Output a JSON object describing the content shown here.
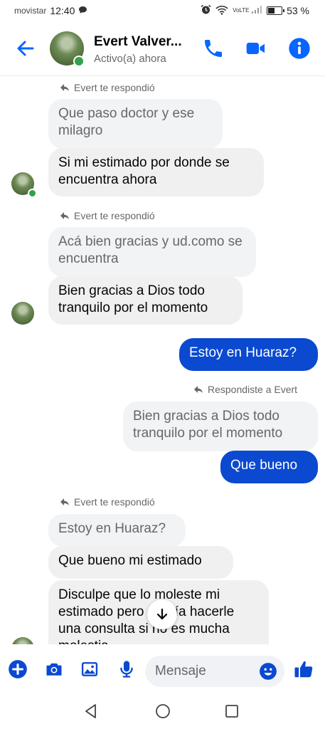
{
  "status_bar": {
    "carrier": "movistar",
    "time": "12:40",
    "volte": "VoLTE",
    "battery_percent": "53 %",
    "battery_level": 0.53
  },
  "header": {
    "contact_name": "Evert Valver...",
    "contact_status": "Activo(a) ahora"
  },
  "messages": [
    {
      "reply_note": "Evert te respondió",
      "quoted": "Que paso doctor y ese milagro",
      "text": "Si mi estimado por donde se encuentra ahora"
    },
    {
      "reply_note": "Evert te respondió",
      "quoted": "Acá bien gracias y ud.como se encuentra",
      "text": "Bien gracias a Dios todo tranquilo por el momento"
    },
    {
      "text": "Estoy en Huaraz?"
    },
    {
      "reply_note": "Respondiste a Evert",
      "quoted": "Bien gracias a Dios todo tranquilo por el momento",
      "text": "Que bueno"
    },
    {
      "reply_note": "Evert te respondió",
      "quoted": "Estoy en Huaraz?",
      "text": "Que bueno mi estimado"
    },
    {
      "text": "Disculpe que lo moleste mi estimado pero quería hacerle una consulta si no es mucha molestia"
    }
  ],
  "composer": {
    "placeholder": "Mensaje"
  },
  "colors": {
    "accent": "#0a49d0",
    "icon_blue": "#0866ff",
    "online": "#31a24c",
    "bubble_in": "#f0f0f0"
  },
  "icons": [
    "arrow-left-icon",
    "phone-icon",
    "video-camera-icon",
    "info-icon",
    "reply-arrow-icon",
    "plus-circle-icon",
    "camera-icon",
    "image-icon",
    "microphone-icon",
    "emoji-icon",
    "thumbs-up-icon",
    "arrow-down-icon",
    "nav-back-icon",
    "nav-home-icon",
    "nav-recents-icon"
  ]
}
